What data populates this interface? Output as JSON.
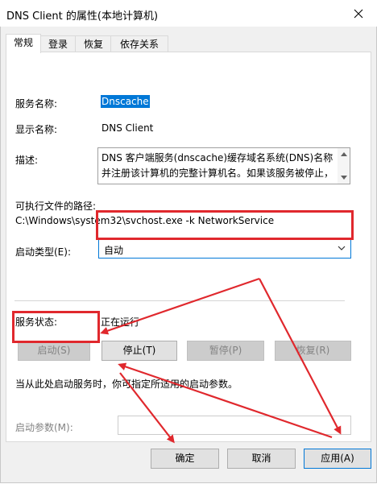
{
  "window": {
    "title": "DNS Client 的属性(本地计算机)"
  },
  "tabs": [
    {
      "label": "常规",
      "active": true
    },
    {
      "label": "登录",
      "active": false
    },
    {
      "label": "恢复",
      "active": false
    },
    {
      "label": "依存关系",
      "active": false
    }
  ],
  "general": {
    "service_name_label": "服务名称:",
    "service_name_value": "Dnscache",
    "display_name_label": "显示名称:",
    "display_name_value": "DNS Client",
    "description_label": "描述:",
    "description_text": "DNS 客户端服务(dnscache)缓存域名系统(DNS)名称并注册该计算机的完整计算机名。如果该服务被停止，",
    "exe_path_label": "可执行文件的路径:",
    "exe_path_value": "C:\\Windows\\system32\\svchost.exe -k NetworkService",
    "startup_type_label": "启动类型(E):",
    "startup_type_value": "自动",
    "service_status_label": "服务状态:",
    "service_status_value": "正在运行",
    "start_button": "启动(S)",
    "stop_button": "停止(T)",
    "pause_button": "暂停(P)",
    "resume_button": "恢复(R)",
    "hint_text": "当从此处启动服务时，你可指定所适用的启动参数。",
    "start_params_label": "启动参数(M):",
    "start_params_value": ""
  },
  "footer": {
    "ok_button": "确定",
    "cancel_button": "取消",
    "apply_button": "应用(A)"
  },
  "colors": {
    "accent": "#0078d7",
    "annotation": "#e0282d"
  }
}
